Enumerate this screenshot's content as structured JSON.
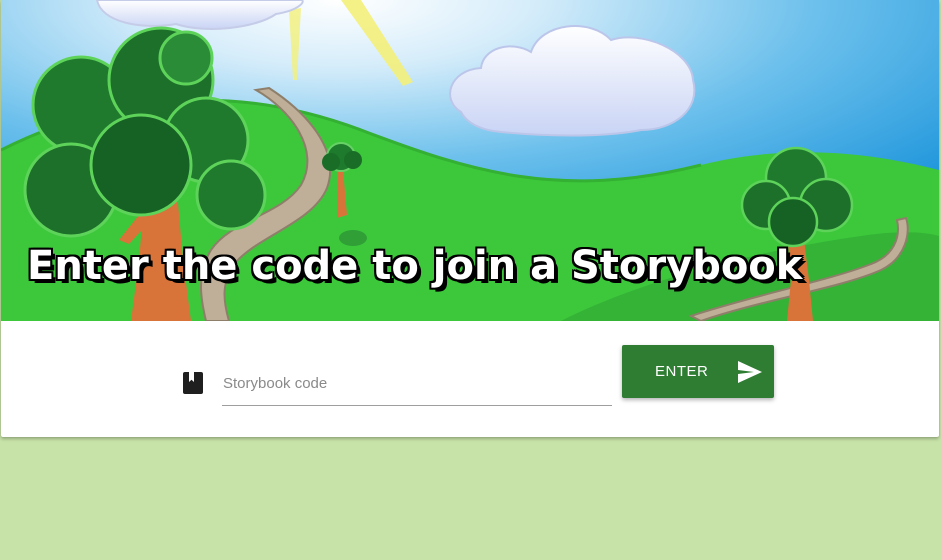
{
  "hero": {
    "title": "Enter the code to join a Storybook",
    "image": "storybook-landscape-illustration"
  },
  "form": {
    "icon": "book-icon",
    "code_placeholder": "Storybook code",
    "code_value": "",
    "submit_label": "ENTER",
    "submit_icon": "send-icon"
  },
  "colors": {
    "page_background": "#c7e3a8",
    "button": "#2e7d32",
    "sky": "#2ea0dc",
    "grass": "#3cc83c"
  }
}
